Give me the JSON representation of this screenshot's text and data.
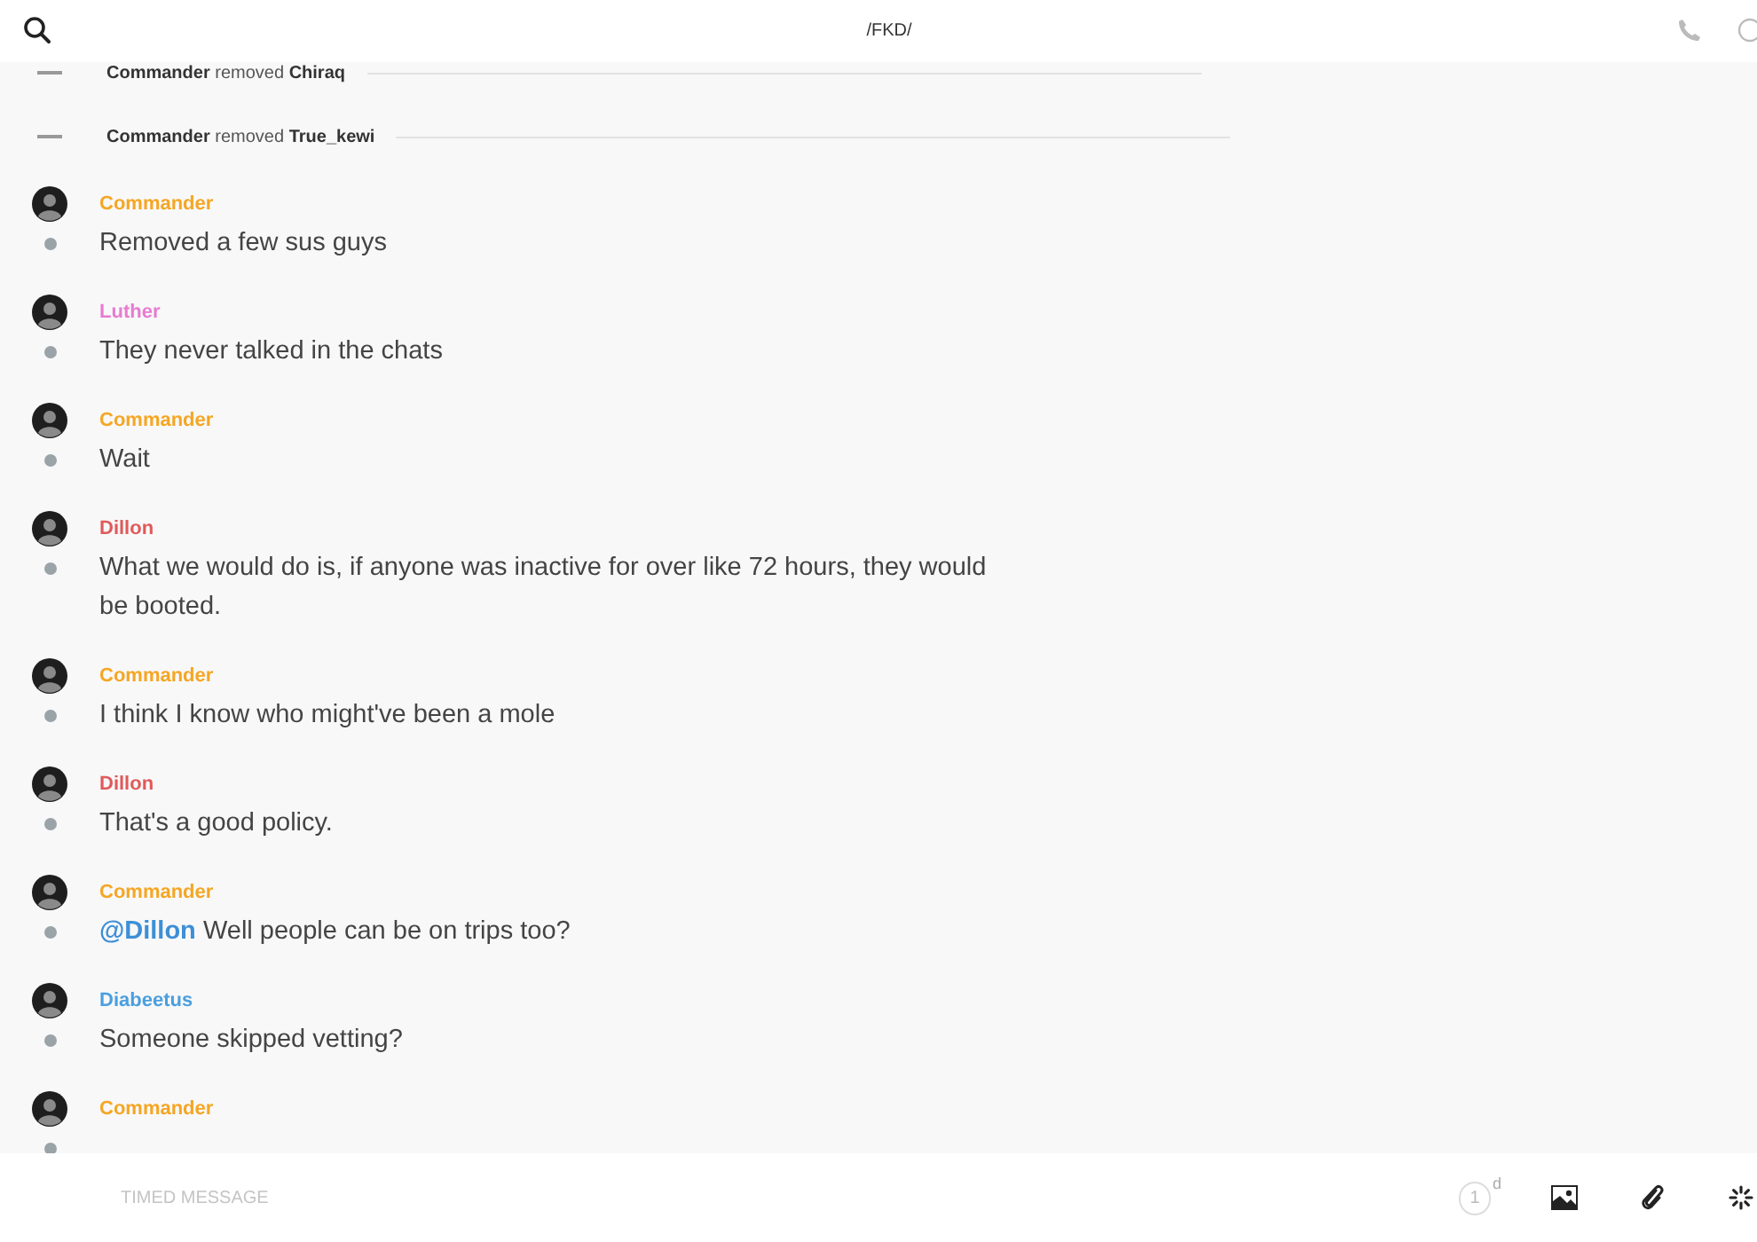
{
  "header": {
    "title": "/FKD/"
  },
  "feed": [
    {
      "kind": "system",
      "text": "**Commander** removed **Chiraq**"
    },
    {
      "kind": "system",
      "text": "**Commander** removed **True_kewi**"
    },
    {
      "kind": "message",
      "author": "Commander",
      "color": "#f5a623",
      "text": "Removed a few sus guys"
    },
    {
      "kind": "message",
      "author": "Luther",
      "color": "#e87bd1",
      "text": "They never talked in the chats"
    },
    {
      "kind": "message",
      "author": "Commander",
      "color": "#f5a623",
      "text": "Wait"
    },
    {
      "kind": "message",
      "author": "Dillon",
      "color": "#e05a5a",
      "text": "What we would do is, if anyone was inactive for over like 72 hours, they would be booted."
    },
    {
      "kind": "message",
      "author": "Commander",
      "color": "#f5a623",
      "text": "I think I know who might've been a mole"
    },
    {
      "kind": "message",
      "author": "Dillon",
      "color": "#e05a5a",
      "text": "That's a good policy."
    },
    {
      "kind": "message",
      "author": "Commander",
      "color": "#f5a623",
      "mention": "@Dillon",
      "text": "Well people can be on trips too?"
    },
    {
      "kind": "message",
      "author": "Diabeetus",
      "color": "#4a9fdf",
      "text": "Someone skipped vetting?"
    },
    {
      "kind": "message",
      "author": "Commander",
      "color": "#f5a623"
    }
  ],
  "composer": {
    "placeholder": "TIMED MESSAGE",
    "timer_value": "1",
    "timer_unit": "d"
  }
}
